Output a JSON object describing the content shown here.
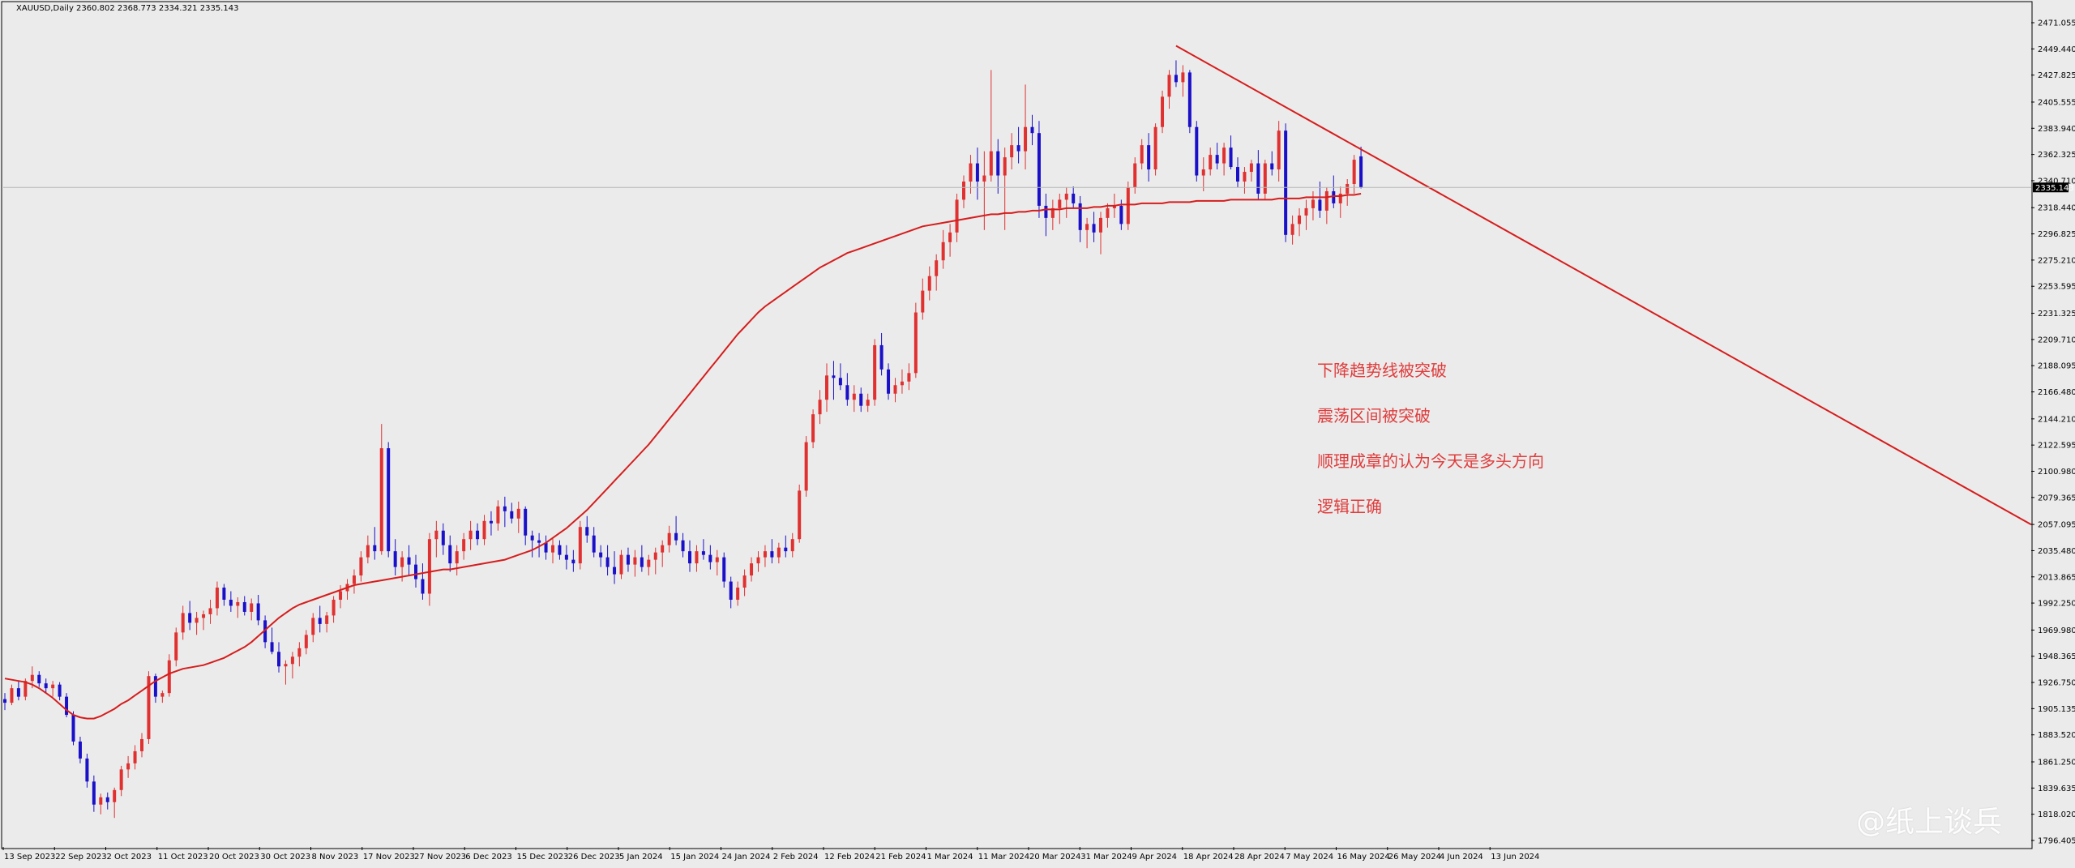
{
  "header": {
    "symbol_label": "XAUUSD,Daily  2360.802 2368.773 2334.321 2335.143"
  },
  "annotations": [
    "下降趋势线被突破",
    "震荡区间被突破",
    "顺理成章的认为今天是多头方向",
    "逻辑正确"
  ],
  "watermark": "@纸上谈兵",
  "colors": {
    "background": "#ebebeb",
    "bull": "#e03030",
    "bear": "#1a10c8",
    "ma": "#d61d1d",
    "trendline": "#d61d1d",
    "text_red": "#e03c3c"
  },
  "chart_data": {
    "type": "candlestick",
    "title": "XAUUSD,Daily",
    "last_price": "2335.143",
    "y_ticks": [
      "2471.055",
      "2449.440",
      "2427.825",
      "2405.555",
      "2383.940",
      "2362.325",
      "2340.710",
      "2318.440",
      "2296.825",
      "2275.210",
      "2253.595",
      "2231.325",
      "2209.710",
      "2188.095",
      "2166.480",
      "2144.210",
      "2122.595",
      "2100.980",
      "2079.365",
      "2057.095",
      "2035.480",
      "2013.865",
      "1992.250",
      "1969.980",
      "1948.365",
      "1926.750",
      "1905.135",
      "1883.520",
      "1861.250",
      "1839.635",
      "1818.020",
      "1796.405"
    ],
    "ylim": [
      1796.405,
      2471.055
    ],
    "x_ticks": [
      "13 Sep 2023",
      "22 Sep 2023",
      "2 Oct 2023",
      "11 Oct 2023",
      "20 Oct 2023",
      "30 Oct 2023",
      "8 Nov 2023",
      "17 Nov 2023",
      "27 Nov 2023",
      "6 Dec 2023",
      "15 Dec 2023",
      "26 Dec 2023",
      "5 Jan 2024",
      "15 Jan 2024",
      "24 Jan 2024",
      "2 Feb 2024",
      "12 Feb 2024",
      "21 Feb 2024",
      "1 Mar 2024",
      "11 Mar 2024",
      "20 Mar 2024",
      "31 Mar 2024",
      "9 Apr 2024",
      "18 Apr 2024",
      "28 Apr 2024",
      "7 May 2024",
      "16 May 2024",
      "26 May 2024",
      "4 Jun 2024",
      "13 Jun 2024"
    ],
    "candles": [
      [
        1913,
        1918,
        1904,
        1910
      ],
      [
        1910,
        1925,
        1908,
        1922
      ],
      [
        1922,
        1928,
        1912,
        1915
      ],
      [
        1915,
        1930,
        1912,
        1928
      ],
      [
        1928,
        1940,
        1922,
        1933
      ],
      [
        1933,
        1936,
        1923,
        1926
      ],
      [
        1926,
        1930,
        1918,
        1922
      ],
      [
        1922,
        1928,
        1915,
        1925
      ],
      [
        1925,
        1927,
        1912,
        1915
      ],
      [
        1915,
        1918,
        1898,
        1900
      ],
      [
        1900,
        1903,
        1875,
        1878
      ],
      [
        1878,
        1882,
        1860,
        1864
      ],
      [
        1864,
        1868,
        1840,
        1845
      ],
      [
        1845,
        1850,
        1820,
        1826
      ],
      [
        1826,
        1835,
        1818,
        1832
      ],
      [
        1832,
        1836,
        1822,
        1828
      ],
      [
        1828,
        1840,
        1815,
        1838
      ],
      [
        1838,
        1858,
        1833,
        1855
      ],
      [
        1855,
        1866,
        1848,
        1860
      ],
      [
        1860,
        1875,
        1855,
        1870
      ],
      [
        1870,
        1885,
        1865,
        1880
      ],
      [
        1880,
        1936,
        1876,
        1932
      ],
      [
        1932,
        1934,
        1910,
        1915
      ],
      [
        1915,
        1920,
        1910,
        1918
      ],
      [
        1918,
        1950,
        1915,
        1945
      ],
      [
        1945,
        1972,
        1940,
        1968
      ],
      [
        1968,
        1990,
        1962,
        1984
      ],
      [
        1984,
        1994,
        1970,
        1976
      ],
      [
        1976,
        1985,
        1966,
        1980
      ],
      [
        1980,
        1986,
        1970,
        1983
      ],
      [
        1983,
        1995,
        1975,
        1988
      ],
      [
        1988,
        2010,
        1982,
        2005
      ],
      [
        2005,
        2008,
        1990,
        1995
      ],
      [
        1995,
        2002,
        1985,
        1990
      ],
      [
        1990,
        1997,
        1980,
        1993
      ],
      [
        1993,
        1998,
        1982,
        1985
      ],
      [
        1985,
        1996,
        1978,
        1992
      ],
      [
        1992,
        1999,
        1974,
        1978
      ],
      [
        1978,
        1982,
        1955,
        1960
      ],
      [
        1960,
        1972,
        1950,
        1952
      ],
      [
        1952,
        1960,
        1935,
        1940
      ],
      [
        1940,
        1945,
        1925,
        1942
      ],
      [
        1942,
        1952,
        1930,
        1948
      ],
      [
        1948,
        1960,
        1940,
        1955
      ],
      [
        1955,
        1970,
        1950,
        1966
      ],
      [
        1966,
        1984,
        1960,
        1980
      ],
      [
        1980,
        1990,
        1968,
        1975
      ],
      [
        1975,
        1985,
        1968,
        1982
      ],
      [
        1982,
        1998,
        1976,
        1995
      ],
      [
        1995,
        2007,
        1988,
        2002
      ],
      [
        2002,
        2012,
        1995,
        2008
      ],
      [
        2008,
        2020,
        2000,
        2015
      ],
      [
        2015,
        2035,
        2010,
        2030
      ],
      [
        2030,
        2048,
        2025,
        2040
      ],
      [
        2040,
        2055,
        2028,
        2035
      ],
      [
        2035,
        2140,
        2032,
        2120
      ],
      [
        2120,
        2125,
        2030,
        2035
      ],
      [
        2035,
        2045,
        2015,
        2022
      ],
      [
        2022,
        2035,
        2010,
        2030
      ],
      [
        2030,
        2040,
        2015,
        2024
      ],
      [
        2024,
        2032,
        2005,
        2012
      ],
      [
        2012,
        2025,
        1995,
        2000
      ],
      [
        2000,
        2050,
        1990,
        2045
      ],
      [
        2045,
        2060,
        2030,
        2052
      ],
      [
        2052,
        2058,
        2032,
        2040
      ],
      [
        2040,
        2048,
        2018,
        2025
      ],
      [
        2025,
        2040,
        2015,
        2035
      ],
      [
        2035,
        2050,
        2028,
        2045
      ],
      [
        2045,
        2060,
        2036,
        2052
      ],
      [
        2052,
        2058,
        2040,
        2045
      ],
      [
        2045,
        2065,
        2040,
        2060
      ],
      [
        2060,
        2068,
        2048,
        2058
      ],
      [
        2058,
        2077,
        2052,
        2072
      ],
      [
        2072,
        2080,
        2055,
        2068
      ],
      [
        2068,
        2075,
        2058,
        2062
      ],
      [
        2062,
        2076,
        2050,
        2070
      ],
      [
        2070,
        2072,
        2040,
        2048
      ],
      [
        2048,
        2052,
        2030,
        2044
      ],
      [
        2044,
        2050,
        2030,
        2042
      ],
      [
        2042,
        2048,
        2028,
        2034
      ],
      [
        2034,
        2046,
        2025,
        2040
      ],
      [
        2040,
        2044,
        2028,
        2032
      ],
      [
        2032,
        2040,
        2020,
        2028
      ],
      [
        2028,
        2036,
        2018,
        2025
      ],
      [
        2025,
        2060,
        2020,
        2055
      ],
      [
        2055,
        2064,
        2042,
        2048
      ],
      [
        2048,
        2055,
        2030,
        2034
      ],
      [
        2034,
        2040,
        2022,
        2030
      ],
      [
        2030,
        2040,
        2015,
        2022
      ],
      [
        2022,
        2035,
        2008,
        2016
      ],
      [
        2016,
        2036,
        2012,
        2032
      ],
      [
        2032,
        2038,
        2018,
        2024
      ],
      [
        2024,
        2036,
        2014,
        2030
      ],
      [
        2030,
        2040,
        2018,
        2022
      ],
      [
        2022,
        2032,
        2015,
        2028
      ],
      [
        2028,
        2038,
        2016,
        2034
      ],
      [
        2034,
        2044,
        2022,
        2040
      ],
      [
        2040,
        2056,
        2034,
        2050
      ],
      [
        2050,
        2064,
        2040,
        2044
      ],
      [
        2044,
        2050,
        2030,
        2035
      ],
      [
        2035,
        2044,
        2018,
        2025
      ],
      [
        2025,
        2040,
        2018,
        2035
      ],
      [
        2035,
        2045,
        2028,
        2032
      ],
      [
        2032,
        2040,
        2020,
        2026
      ],
      [
        2026,
        2036,
        2015,
        2030
      ],
      [
        2030,
        2034,
        2005,
        2010
      ],
      [
        2010,
        2014,
        1988,
        1995
      ],
      [
        1995,
        2010,
        1990,
        2005
      ],
      [
        2005,
        2020,
        1998,
        2015
      ],
      [
        2015,
        2030,
        2010,
        2025
      ],
      [
        2025,
        2035,
        2018,
        2030
      ],
      [
        2030,
        2040,
        2022,
        2035
      ],
      [
        2035,
        2045,
        2025,
        2030
      ],
      [
        2030,
        2042,
        2025,
        2038
      ],
      [
        2038,
        2048,
        2030,
        2035
      ],
      [
        2035,
        2050,
        2030,
        2045
      ],
      [
        2045,
        2090,
        2042,
        2085
      ],
      [
        2085,
        2130,
        2080,
        2125
      ],
      [
        2125,
        2152,
        2120,
        2148
      ],
      [
        2148,
        2168,
        2140,
        2160
      ],
      [
        2160,
        2190,
        2150,
        2180
      ],
      [
        2180,
        2192,
        2160,
        2178
      ],
      [
        2178,
        2190,
        2168,
        2172
      ],
      [
        2172,
        2182,
        2155,
        2160
      ],
      [
        2160,
        2172,
        2150,
        2165
      ],
      [
        2165,
        2170,
        2150,
        2155
      ],
      [
        2155,
        2165,
        2150,
        2160
      ],
      [
        2160,
        2210,
        2155,
        2205
      ],
      [
        2205,
        2215,
        2180,
        2185
      ],
      [
        2185,
        2190,
        2160,
        2165
      ],
      [
        2165,
        2178,
        2158,
        2172
      ],
      [
        2172,
        2185,
        2165,
        2175
      ],
      [
        2175,
        2190,
        2168,
        2182
      ],
      [
        2182,
        2240,
        2178,
        2232
      ],
      [
        2232,
        2260,
        2226,
        2250
      ],
      [
        2250,
        2270,
        2242,
        2262
      ],
      [
        2262,
        2280,
        2250,
        2275
      ],
      [
        2275,
        2300,
        2268,
        2290
      ],
      [
        2290,
        2305,
        2278,
        2298
      ],
      [
        2298,
        2330,
        2290,
        2325
      ],
      [
        2325,
        2345,
        2318,
        2340
      ],
      [
        2340,
        2362,
        2330,
        2355
      ],
      [
        2355,
        2368,
        2325,
        2340
      ],
      [
        2340,
        2365,
        2300,
        2345
      ],
      [
        2345,
        2432,
        2340,
        2365
      ],
      [
        2365,
        2375,
        2330,
        2345
      ],
      [
        2345,
        2368,
        2300,
        2360
      ],
      [
        2360,
        2380,
        2350,
        2370
      ],
      [
        2370,
        2385,
        2355,
        2365
      ],
      [
        2365,
        2420,
        2350,
        2385
      ],
      [
        2385,
        2395,
        2370,
        2380
      ],
      [
        2380,
        2390,
        2310,
        2320
      ],
      [
        2320,
        2330,
        2295,
        2310
      ],
      [
        2310,
        2325,
        2300,
        2318
      ],
      [
        2318,
        2330,
        2305,
        2325
      ],
      [
        2325,
        2335,
        2310,
        2330
      ],
      [
        2330,
        2336,
        2318,
        2322
      ],
      [
        2322,
        2328,
        2290,
        2300
      ],
      [
        2300,
        2310,
        2285,
        2305
      ],
      [
        2305,
        2315,
        2290,
        2298
      ],
      [
        2298,
        2315,
        2280,
        2310
      ],
      [
        2310,
        2322,
        2302,
        2318
      ],
      [
        2318,
        2330,
        2310,
        2320
      ],
      [
        2320,
        2325,
        2300,
        2305
      ],
      [
        2305,
        2340,
        2300,
        2335
      ],
      [
        2335,
        2360,
        2330,
        2355
      ],
      [
        2355,
        2375,
        2350,
        2370
      ],
      [
        2370,
        2380,
        2340,
        2350
      ],
      [
        2350,
        2388,
        2345,
        2385
      ],
      [
        2385,
        2415,
        2380,
        2410
      ],
      [
        2410,
        2432,
        2400,
        2428
      ],
      [
        2428,
        2440,
        2418,
        2422
      ],
      [
        2422,
        2436,
        2410,
        2430
      ],
      [
        2430,
        2432,
        2380,
        2385
      ],
      [
        2385,
        2390,
        2340,
        2345
      ],
      [
        2345,
        2360,
        2332,
        2350
      ],
      [
        2350,
        2368,
        2345,
        2362
      ],
      [
        2362,
        2372,
        2350,
        2355
      ],
      [
        2355,
        2372,
        2345,
        2368
      ],
      [
        2368,
        2378,
        2350,
        2352
      ],
      [
        2352,
        2360,
        2335,
        2340
      ],
      [
        2340,
        2352,
        2330,
        2348
      ],
      [
        2348,
        2358,
        2340,
        2355
      ],
      [
        2355,
        2366,
        2325,
        2330
      ],
      [
        2330,
        2358,
        2325,
        2355
      ],
      [
        2355,
        2365,
        2345,
        2350
      ],
      [
        2350,
        2390,
        2340,
        2382
      ],
      [
        2382,
        2388,
        2290,
        2296
      ],
      [
        2296,
        2312,
        2288,
        2305
      ],
      [
        2305,
        2318,
        2295,
        2312
      ],
      [
        2312,
        2325,
        2300,
        2318
      ],
      [
        2318,
        2332,
        2308,
        2325
      ],
      [
        2325,
        2340,
        2310,
        2316
      ],
      [
        2316,
        2335,
        2305,
        2332
      ],
      [
        2332,
        2345,
        2318,
        2322
      ],
      [
        2322,
        2336,
        2310,
        2330
      ],
      [
        2330,
        2342,
        2320,
        2338
      ],
      [
        2338,
        2362,
        2330,
        2358
      ],
      [
        2360.802,
        2368.773,
        2334.321,
        2335.143
      ]
    ],
    "ma_values": [
      1930,
      1929,
      1928,
      1927,
      1925,
      1922,
      1918,
      1914,
      1909,
      1904,
      1900,
      1898,
      1897,
      1897,
      1899,
      1902,
      1905,
      1909,
      1912,
      1916,
      1920,
      1924,
      1928,
      1931,
      1934,
      1936,
      1938,
      1939,
      1940,
      1941,
      1943,
      1945,
      1947,
      1950,
      1953,
      1956,
      1960,
      1965,
      1970,
      1975,
      1980,
      1984,
      1988,
      1991,
      1993,
      1995,
      1997,
      1999,
      2001,
      2003,
      2005,
      2007,
      2008,
      2009,
      2010,
      2011,
      2012,
      2013,
      2014,
      2015,
      2016,
      2017,
      2018,
      2019,
      2020,
      2020,
      2021,
      2022,
      2023,
      2024,
      2025,
      2026,
      2027,
      2028,
      2030,
      2032,
      2034,
      2036,
      2039,
      2042,
      2046,
      2050,
      2054,
      2059,
      2064,
      2069,
      2075,
      2081,
      2087,
      2093,
      2099,
      2105,
      2111,
      2117,
      2123,
      2130,
      2137,
      2144,
      2151,
      2158,
      2165,
      2172,
      2179,
      2186,
      2193,
      2200,
      2207,
      2214,
      2220,
      2226,
      2232,
      2237,
      2241,
      2245,
      2249,
      2253,
      2257,
      2261,
      2265,
      2269,
      2272,
      2275,
      2278,
      2281,
      2283,
      2285,
      2287,
      2289,
      2291,
      2293,
      2295,
      2297,
      2299,
      2301,
      2303,
      2304,
      2305,
      2306,
      2307,
      2308,
      2309,
      2310,
      2311,
      2312,
      2313,
      2313,
      2314,
      2314,
      2315,
      2315,
      2316,
      2316,
      2317,
      2317,
      2317,
      2318,
      2318,
      2318,
      2318,
      2319,
      2319,
      2320,
      2320,
      2321,
      2321,
      2321,
      2322,
      2322,
      2322,
      2322,
      2323,
      2323,
      2323,
      2323,
      2324,
      2324,
      2324,
      2324,
      2324,
      2325,
      2325,
      2325,
      2325,
      2325,
      2325,
      2325,
      2326,
      2326,
      2326,
      2326,
      2327,
      2327,
      2327,
      2327,
      2328,
      2328,
      2329,
      2329,
      2330
    ],
    "trendline": {
      "start_price": 2452,
      "end_price": 2057
    },
    "grid": false,
    "legend": "none"
  }
}
